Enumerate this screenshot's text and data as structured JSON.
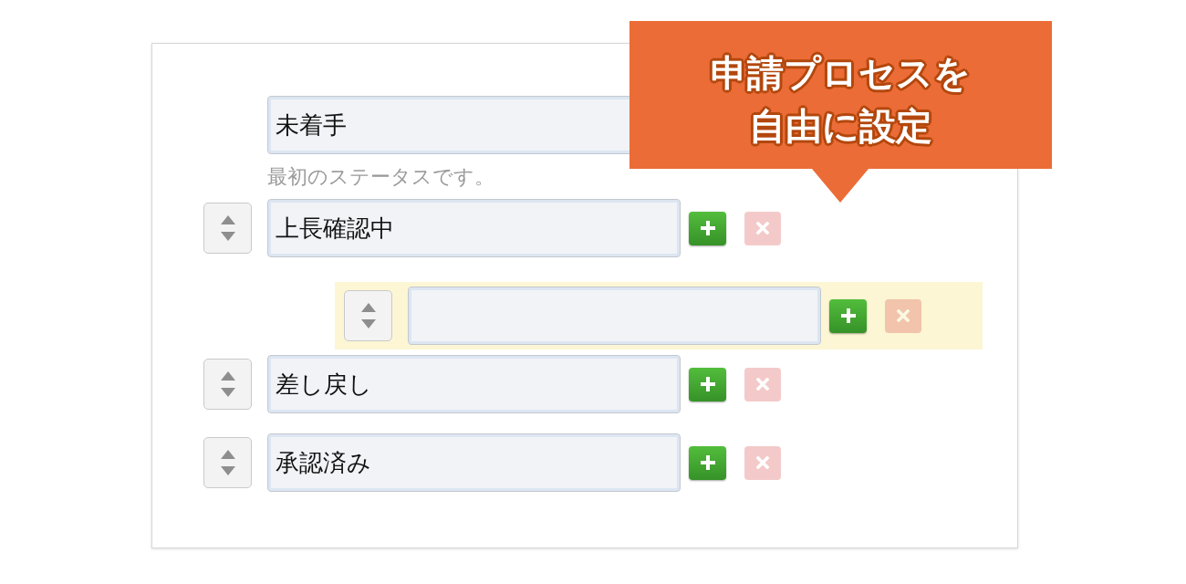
{
  "callout": {
    "lines": [
      "申請プロセスを",
      "自由に設定"
    ]
  },
  "statuses": [
    {
      "value": "未着手",
      "sortable": false,
      "dragging": false,
      "hint": "最初のステータスです。"
    },
    {
      "value": "上長確認中",
      "sortable": true,
      "dragging": false,
      "add": {
        "disabled": false
      },
      "remove": {
        "disabled": true
      }
    },
    {
      "sortable": true,
      "dragging": true,
      "add": {
        "disabled": false
      },
      "remove": {
        "disabled": true
      }
    },
    {
      "value": "差し戻し",
      "sortable": true,
      "dragging": false,
      "add": {
        "disabled": false
      },
      "remove": {
        "disabled": true
      }
    },
    {
      "value": "承認済み",
      "sortable": true,
      "dragging": false,
      "add": {
        "disabled": false
      },
      "remove": {
        "disabled": true
      }
    }
  ]
}
